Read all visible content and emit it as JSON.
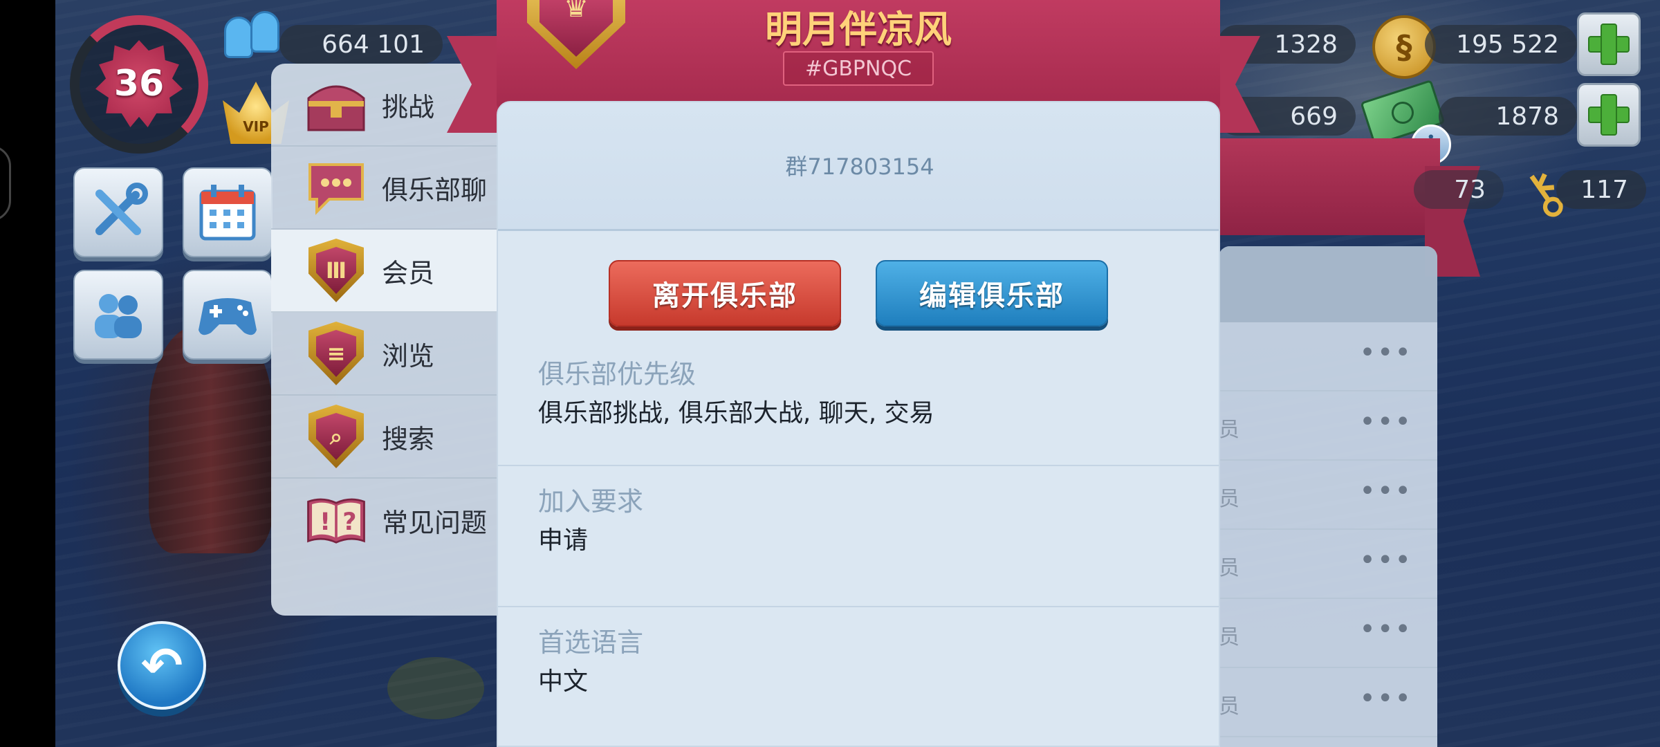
{
  "hud": {
    "level": "36",
    "players_count": "664 101",
    "vip_label": "VIP",
    "stat_1": "1328",
    "coins": "195 522",
    "stat_2": "669",
    "cash": "1878",
    "stat_3_partial": "73",
    "keys": "117",
    "coin_symbol": "§",
    "info_symbol": "i"
  },
  "menu": {
    "items": [
      {
        "label": "挑战",
        "icon": "treasure-chest-icon"
      },
      {
        "label": "俱乐部聊",
        "icon": "chat-bubble-icon"
      },
      {
        "label": "会员",
        "icon": "club-shield-icon"
      },
      {
        "label": "浏览",
        "icon": "browse-shield-icon"
      },
      {
        "label": "搜索",
        "icon": "search-shield-icon"
      },
      {
        "label": "常见问题",
        "icon": "faq-book-icon"
      }
    ]
  },
  "dialog": {
    "club_name": "明月伴凉风",
    "club_tag": "#GBPNQC",
    "description": "群717803154",
    "leave_button": "离开俱乐部",
    "edit_button": "编辑俱乐部",
    "sections": [
      {
        "label": "俱乐部优先级",
        "value": "俱乐部挑战, 俱乐部大战, 聊天, 交易"
      },
      {
        "label": "加入要求",
        "value": "申请"
      },
      {
        "label": "首选语言",
        "value": "中文"
      }
    ]
  },
  "member_list": {
    "row_fragment": "员",
    "more_symbol": "•••"
  },
  "colors": {
    "header_red": "#b33457",
    "leave_red": "#d9493b",
    "edit_blue": "#2e94d2",
    "gold": "#ffd27a"
  }
}
